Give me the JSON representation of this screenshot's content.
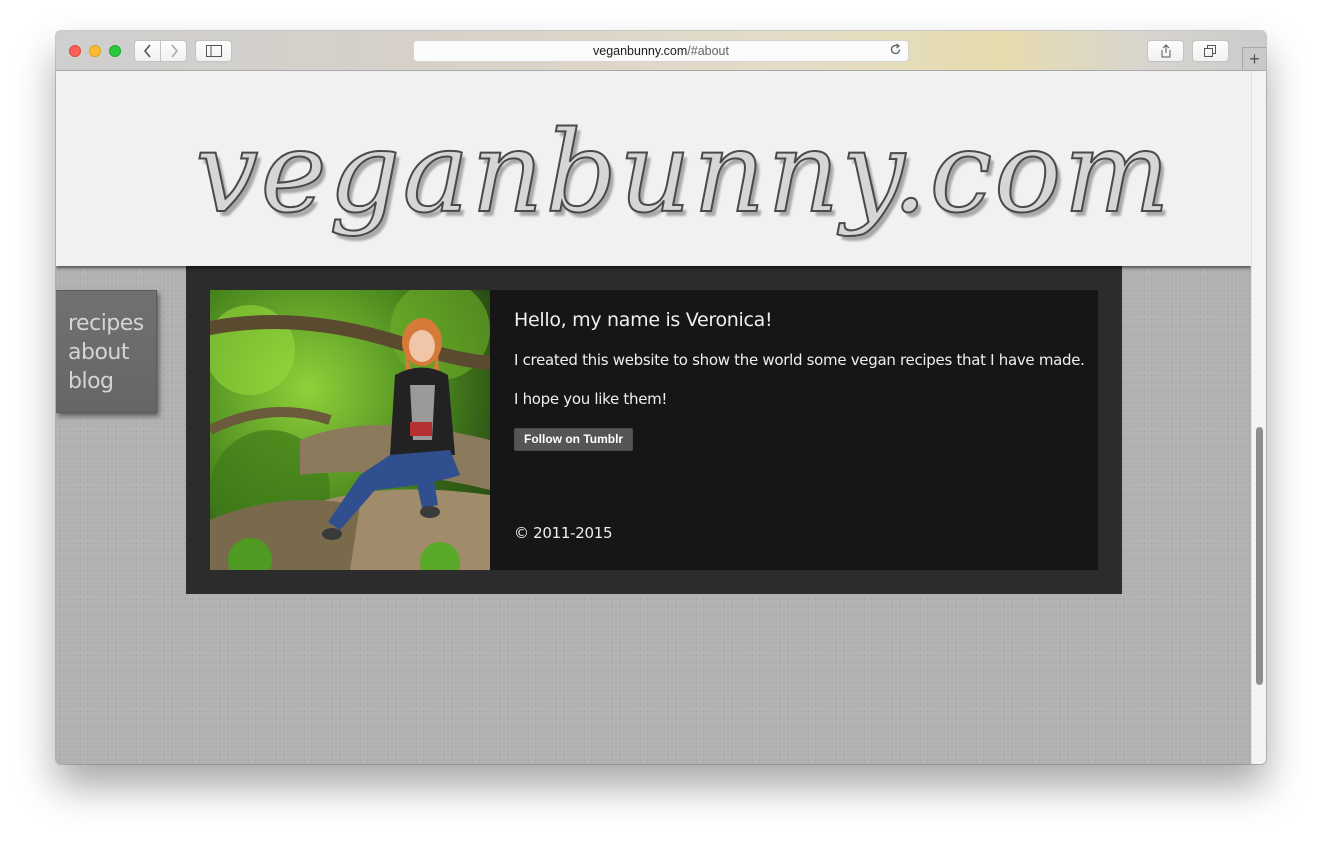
{
  "browser": {
    "url_host": "veganbunny.com",
    "url_path": "/#about",
    "icons": {
      "back": "chevron-left-icon",
      "forward": "chevron-right-icon",
      "sidebar": "sidebar-icon",
      "reload": "reload-icon",
      "share": "share-icon",
      "tabs": "tabs-icon",
      "new_tab": "plus-icon"
    }
  },
  "site": {
    "logo": "veganbunny.com"
  },
  "nav": {
    "items": [
      {
        "label": "recipes"
      },
      {
        "label": "about"
      },
      {
        "label": "blog"
      }
    ]
  },
  "about": {
    "heading": "Hello, my name is Veronica!",
    "paragraph1": "I created this website to show the world some vegan recipes that I have made.",
    "paragraph2": "I hope you like them!",
    "follow_button": "Follow on Tumblr",
    "copyright": "© 2011-2015"
  },
  "colors": {
    "page_bg": "#b1b1b1",
    "header_bg": "#f1f1f1",
    "panel_bg": "#2c2c2c",
    "inner_bg": "#161616",
    "nav_bg": "#6c6c6c"
  }
}
